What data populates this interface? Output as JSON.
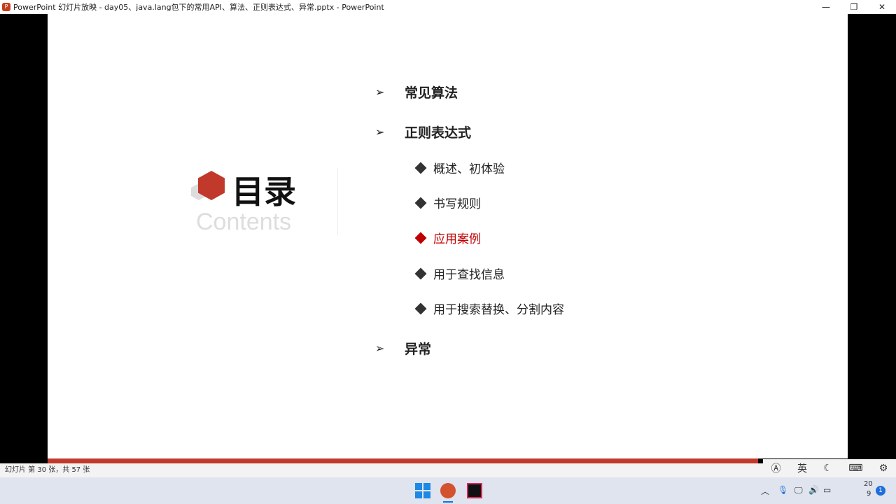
{
  "window": {
    "title": "PowerPoint 幻灯片放映  -  day05、java.lang包下的常用API、算法、正则表达式、异常.pptx - PowerPoint",
    "minimize": "—",
    "restore": "❐",
    "close": "✕"
  },
  "slide": {
    "heading": "目录",
    "subheading": "Contents",
    "items": [
      {
        "label": "常见算法",
        "level": 1
      },
      {
        "label": "正则表达式",
        "level": 1
      },
      {
        "label": "概述、初体验",
        "level": 2
      },
      {
        "label": "书写规则",
        "level": 2
      },
      {
        "label": "应用案例",
        "level": 2,
        "active": true
      },
      {
        "label": "用于查找信息",
        "level": 2
      },
      {
        "label": "用于搜索替换、分割内容",
        "level": 2
      },
      {
        "label": "异常",
        "level": 1
      }
    ],
    "accent": "#c0392b"
  },
  "status": {
    "text": "幻灯片 第 30 张，共 57 张"
  },
  "ime": {
    "lang": "英"
  },
  "tray": {
    "time": "20",
    "date": "9",
    "notifications": "1"
  }
}
